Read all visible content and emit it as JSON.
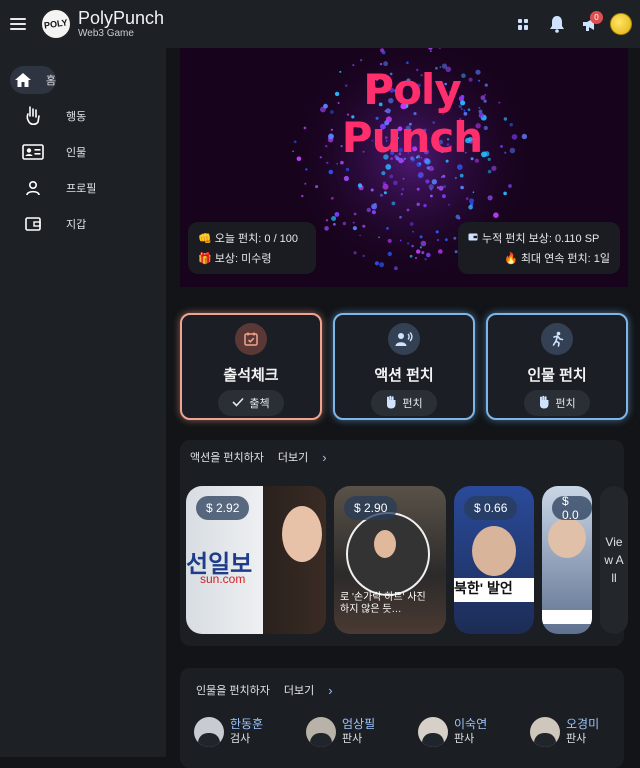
{
  "app": {
    "name": "PolyPunch",
    "subtitle": "Web3 Game",
    "logo_text": "POLY"
  },
  "header": {
    "notification_count": "0",
    "icons": [
      "menu-icon",
      "dashboard-grid-icon",
      "bell-icon",
      "megaphone-icon",
      "avatar"
    ]
  },
  "sidebar": {
    "items": [
      {
        "label": "홈",
        "icon": "home-icon",
        "active": true
      },
      {
        "label": "행동",
        "icon": "hand-icon",
        "active": false
      },
      {
        "label": "인물",
        "icon": "id-card-icon",
        "active": false
      },
      {
        "label": "프로필",
        "icon": "user-icon",
        "active": false
      },
      {
        "label": "지갑",
        "icon": "wallet-icon",
        "active": false
      }
    ]
  },
  "hero": {
    "title_line1": "Poly",
    "title_line2": "Punch",
    "today_punch": "👊 오늘 펀치: 0 / 100",
    "reward": "🎁 보상: 미수령",
    "total_reward": "누적 펀치 보상: 0.110 SP",
    "max_streak": "🔥 최대 연속 펀치: 1일"
  },
  "cards": [
    {
      "title": "출석체크",
      "button": "출첵",
      "icon": "calendar-check-icon"
    },
    {
      "title": "액션 펀치",
      "button": "펀치",
      "icon": "speaker-person-icon"
    },
    {
      "title": "인물 펀치",
      "button": "펀치",
      "icon": "running-person-icon"
    }
  ],
  "actions_section": {
    "heading": "액션을 펀치하자",
    "more": "더보기",
    "items": [
      {
        "price": "$ 2.92",
        "caption": ""
      },
      {
        "price": "$ 2.90",
        "caption": "로 '손가락 하트' 사진\n하지 않은 듯…"
      },
      {
        "price": "$ 0.66",
        "caption": ""
      },
      {
        "price": "$ 0.0",
        "caption": ""
      }
    ],
    "view_all": "View All"
  },
  "people_section": {
    "heading": "인물을 펀치하자",
    "more": "더보기",
    "items": [
      {
        "name": "한동훈",
        "role": "검사"
      },
      {
        "name": "엄상필",
        "role": "판사"
      },
      {
        "name": "이숙연",
        "role": "판사"
      },
      {
        "name": "오경미",
        "role": "판사"
      }
    ]
  },
  "colors": {
    "accent_blue": "#7eb6ea",
    "accent_coral": "#f1a38f",
    "title_pink": "#ff2f6e",
    "link_blue": "#9fc4ff"
  }
}
